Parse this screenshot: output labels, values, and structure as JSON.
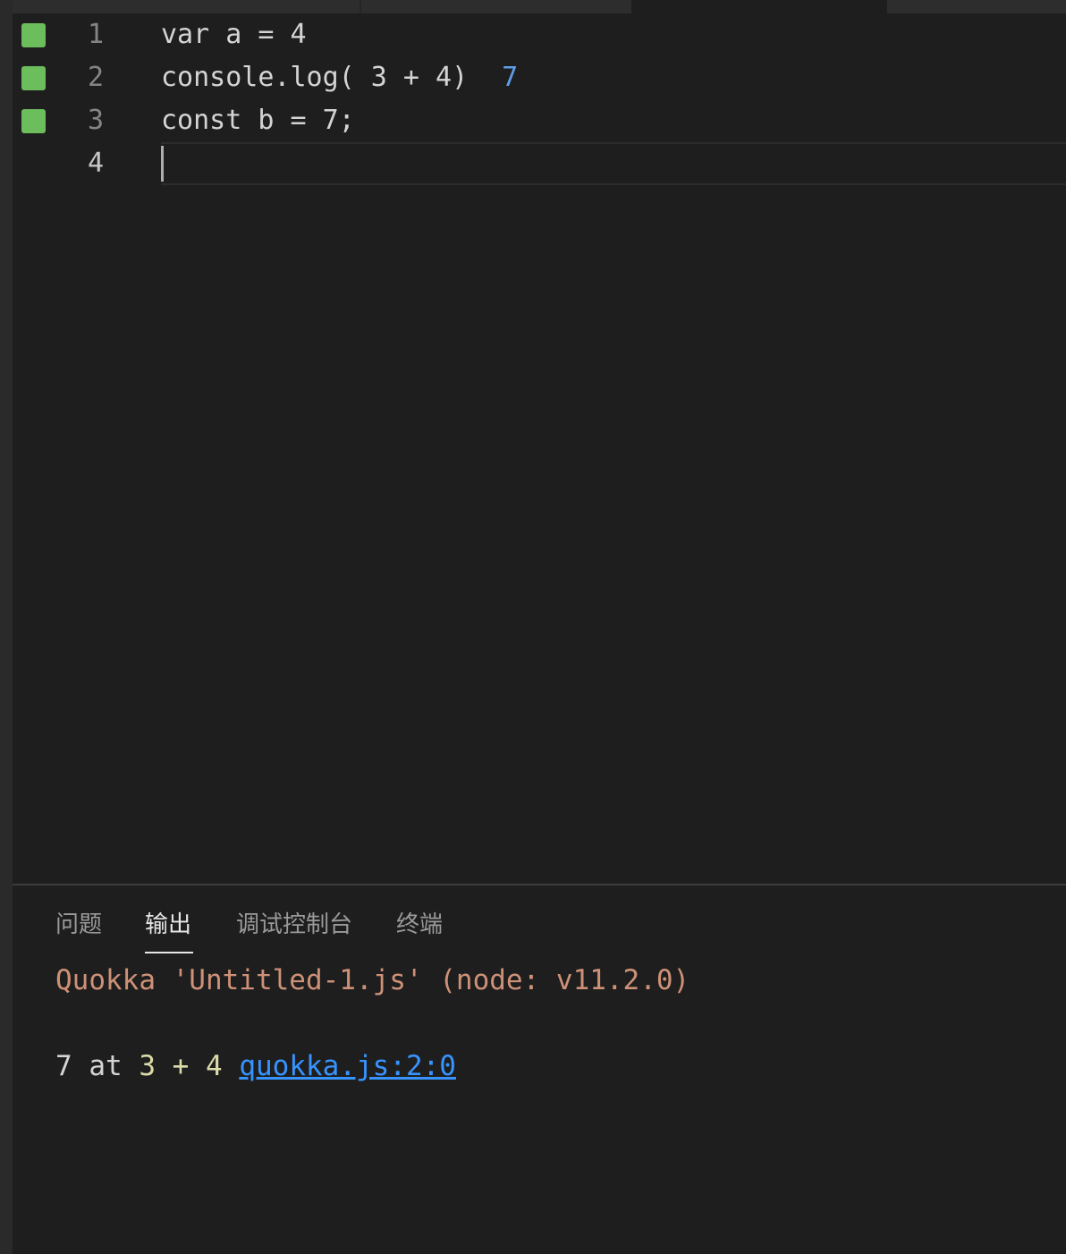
{
  "editor": {
    "lines": [
      {
        "number": "1",
        "code": "var a = 4",
        "result": "",
        "status": "passed"
      },
      {
        "number": "2",
        "code": "console.log( 3 + 4)",
        "result": "7",
        "status": "passed"
      },
      {
        "number": "3",
        "code": "const b = 7;",
        "result": "",
        "status": "passed"
      },
      {
        "number": "4",
        "code": "",
        "result": "",
        "status": ""
      }
    ]
  },
  "panel": {
    "tabs": [
      {
        "label": "问题",
        "active": false
      },
      {
        "label": "输出",
        "active": true
      },
      {
        "label": "调试控制台",
        "active": false
      },
      {
        "label": "终端",
        "active": false
      }
    ],
    "output": {
      "header": "Quokka 'Untitled-1.js' (node: v11.2.0)",
      "result_value": "7",
      "result_at": "at",
      "result_expr": "3 + 4",
      "result_link": "quokka.js:2:0"
    }
  },
  "colors": {
    "marker_green": "#6cbd5c",
    "inline_result_blue": "#5f9ee6",
    "output_header": "#ce9178",
    "link_blue": "#3794ff"
  }
}
